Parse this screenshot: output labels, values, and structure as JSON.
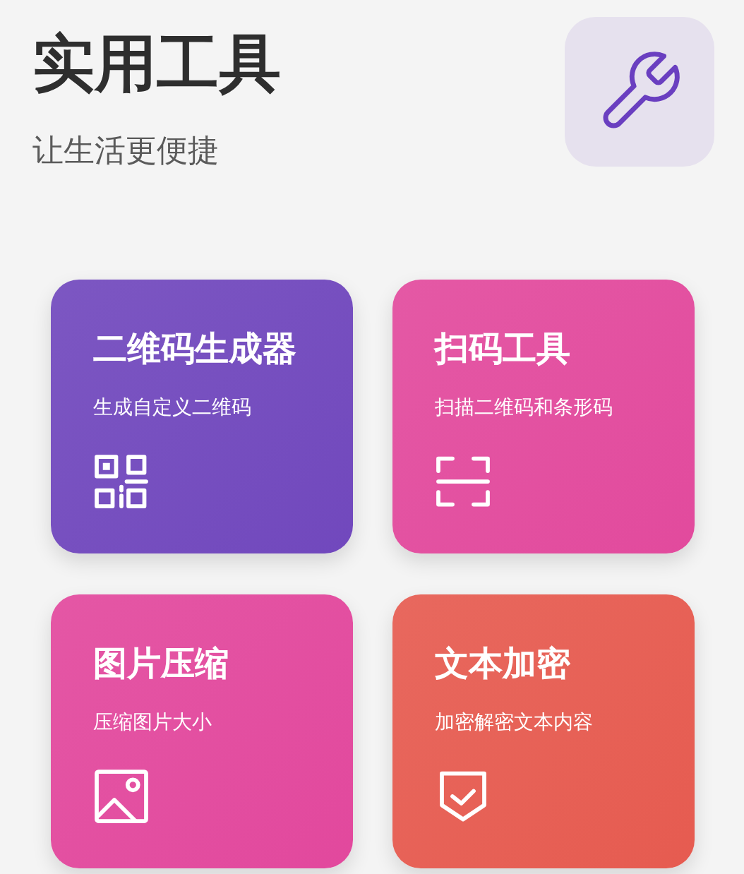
{
  "header": {
    "title": "实用工具",
    "subtitle": "让生活更便捷"
  },
  "tools": [
    {
      "title": "二维码生成器",
      "description": "生成自定义二维码",
      "kind": "qr",
      "color": "#7148bd"
    },
    {
      "title": "扫码工具",
      "description": "扫描二维码和条形码",
      "kind": "scan",
      "color": "#e24a9d"
    },
    {
      "title": "图片压缩",
      "description": "压缩图片大小",
      "kind": "image",
      "color": "#e2489d"
    },
    {
      "title": "文本加密",
      "description": "加密解密文本内容",
      "kind": "shield",
      "color": "#e65b50"
    }
  ]
}
